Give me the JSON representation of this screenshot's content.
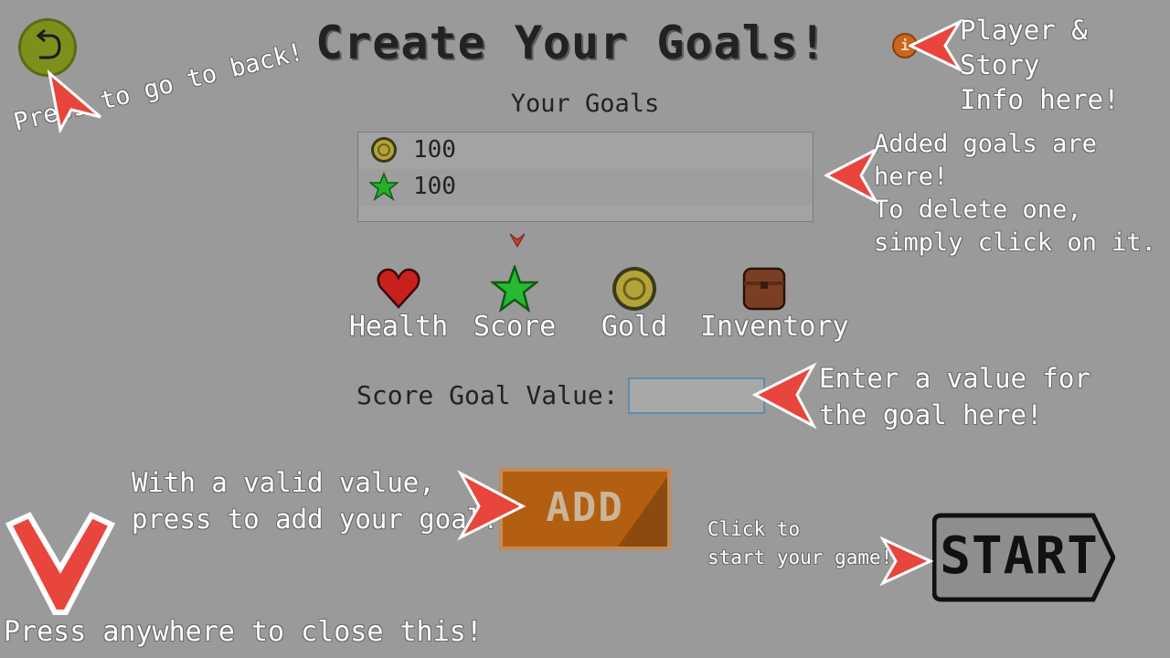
{
  "title": "Create Your Goals!",
  "goals_heading": "Your Goals",
  "goals": [
    {
      "icon": "gold-coin-icon",
      "value": "100"
    },
    {
      "icon": "star-icon",
      "value": "100"
    }
  ],
  "categories": [
    {
      "label": "Health",
      "icon": "heart-icon"
    },
    {
      "label": "Score",
      "icon": "star-icon"
    },
    {
      "label": "Gold",
      "icon": "gold-coin-icon"
    },
    {
      "label": "Inventory",
      "icon": "chest-icon"
    }
  ],
  "goal_value_label": "Score Goal Value:",
  "goal_value_input": "",
  "add_label": "ADD",
  "start_label": "START",
  "info_glyph": "i",
  "hints": {
    "back": "Press to go to back!",
    "info": "Player & Story\nInfo here!",
    "goals": "Added goals are here!\nTo delete one,\nsimply click on it.",
    "value": "Enter a value for\nthe goal here!",
    "add": "With a valid value,\npress to add your goal!",
    "start": "Click to\nstart your game!",
    "close": "Press anywhere to close this!"
  },
  "colors": {
    "background": "#9a9a9a",
    "hint_arrow": "#e8453c",
    "back_button": "#7f8f1b",
    "add_button": "#b35f12",
    "start_button": "#8e8e8e"
  }
}
